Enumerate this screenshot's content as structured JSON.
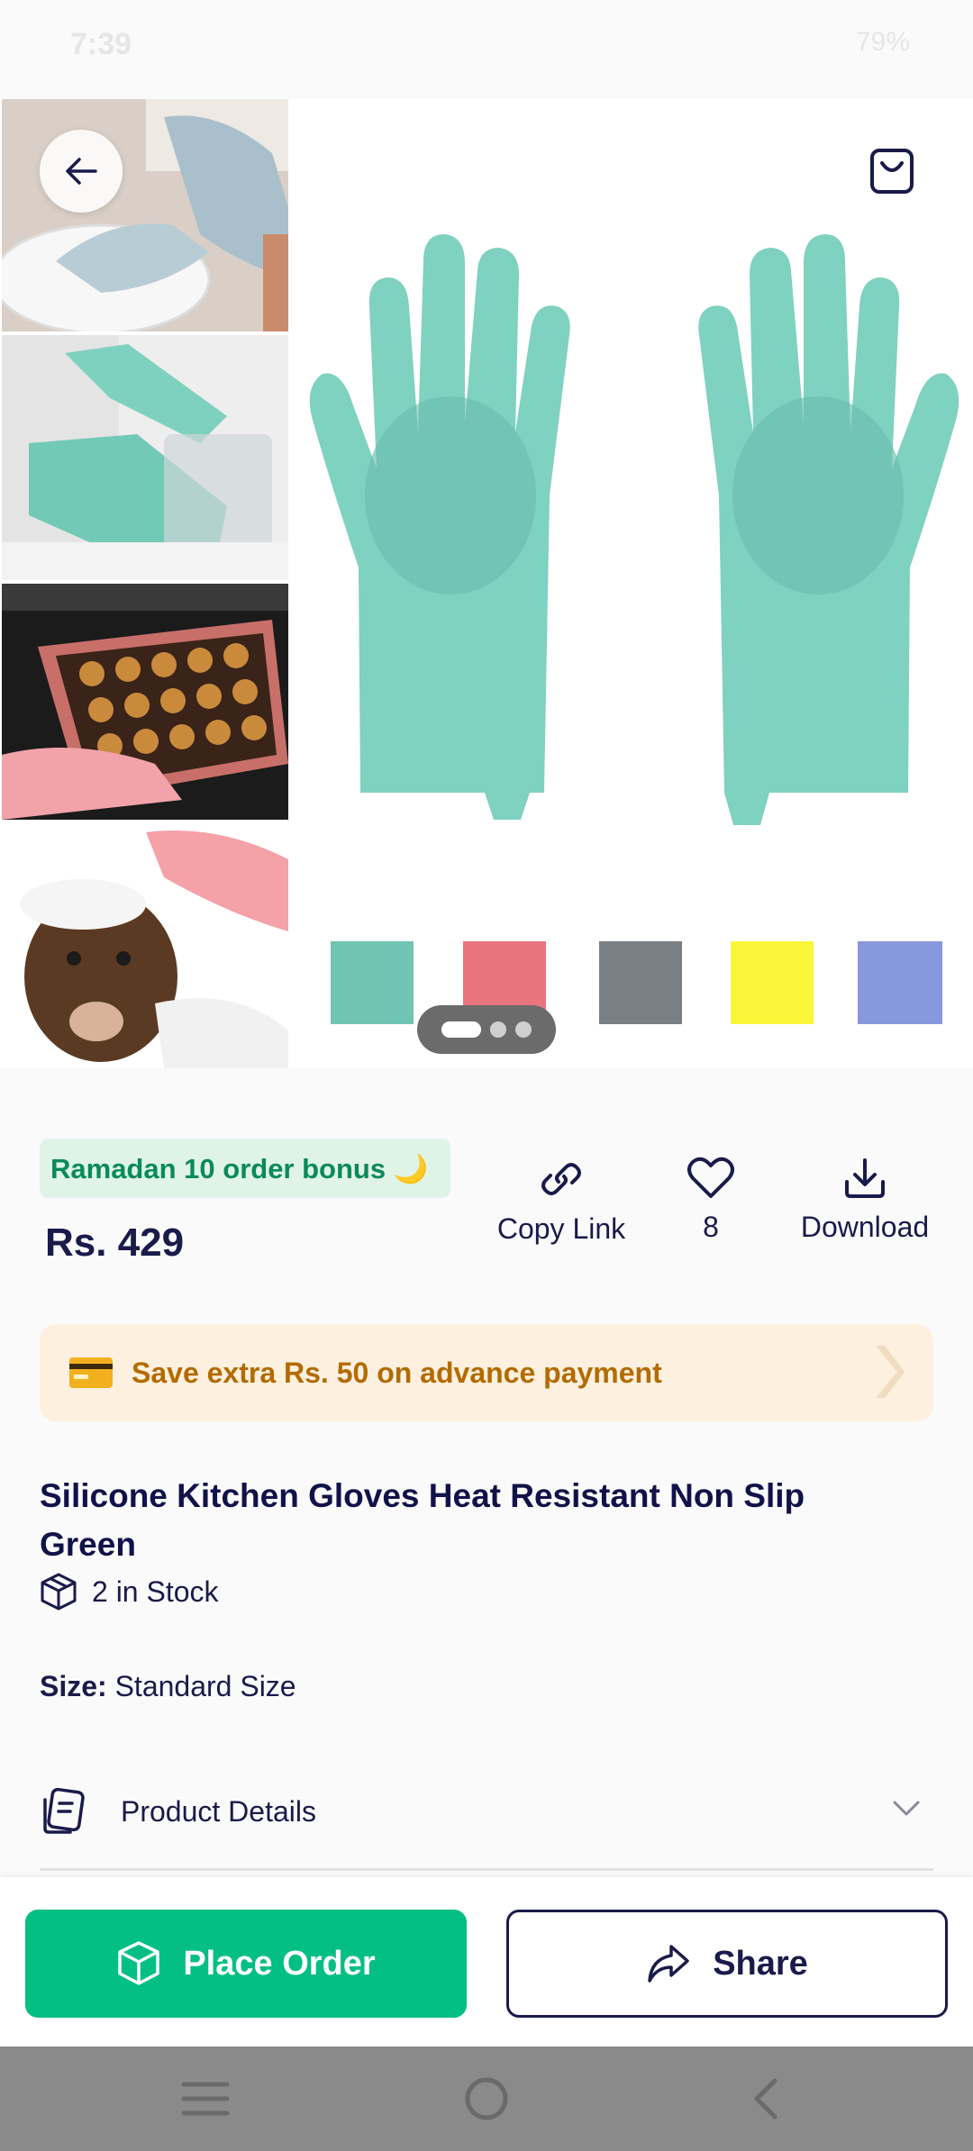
{
  "status_bar": {
    "time": "7:39",
    "battery": "79%"
  },
  "gallery": {
    "swatch_colors": [
      "#6fc4b2",
      "#e8757e",
      "#7a7f83",
      "#fbf53a",
      "#8799dc"
    ],
    "page_count": 3,
    "active_page": 1,
    "glove_color": "#7fd1c0"
  },
  "product": {
    "bonus_badge": "Ramadan 10 order bonus 🌙",
    "price": "Rs. 429",
    "title": "Silicone Kitchen Gloves Heat Resistant Non Slip Green",
    "stock": "2 in Stock",
    "size_label": "Size:",
    "size_value": "Standard Size"
  },
  "actions": {
    "copy_link": "Copy Link",
    "likes_count": "8",
    "download": "Download"
  },
  "promo": {
    "text": "Save extra Rs. 50 on advance payment"
  },
  "details": {
    "label": "Product Details"
  },
  "bottom": {
    "place_order": "Place Order",
    "share": "Share"
  },
  "colors": {
    "accent_green": "#03bf83",
    "navy": "#1a1a4b",
    "promo_bg": "#fdf0de",
    "promo_text": "#b36b00"
  }
}
